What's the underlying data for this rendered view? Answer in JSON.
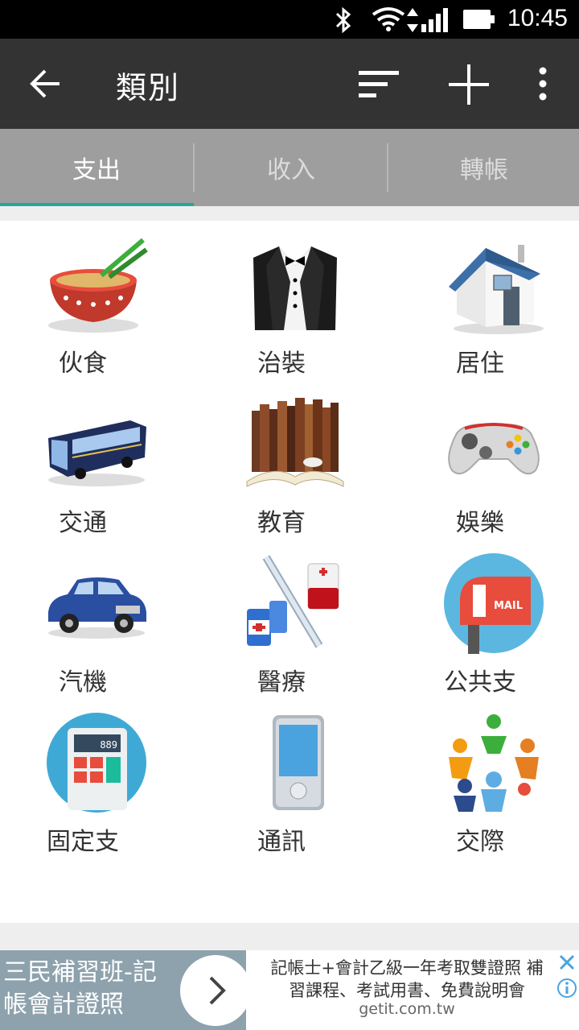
{
  "status_bar": {
    "time": "10:45"
  },
  "app_bar": {
    "title": "類別"
  },
  "tabs": [
    {
      "label": "支出",
      "active": true
    },
    {
      "label": "收入",
      "active": false
    },
    {
      "label": "轉帳",
      "active": false
    }
  ],
  "categories": [
    {
      "label": "伙食",
      "icon": "noodle-bowl-icon"
    },
    {
      "label": "治裝",
      "icon": "tuxedo-icon"
    },
    {
      "label": "居住",
      "icon": "house-icon"
    },
    {
      "label": "交通",
      "icon": "bus-icon"
    },
    {
      "label": "教育",
      "icon": "books-icon"
    },
    {
      "label": "娛樂",
      "icon": "gamepad-icon"
    },
    {
      "label": "汽機",
      "icon": "car-icon"
    },
    {
      "label": "醫療",
      "icon": "medical-icon"
    },
    {
      "label": "公共支",
      "icon": "mailbox-icon"
    },
    {
      "label": "固定支",
      "icon": "calculator-icon"
    },
    {
      "label": "通訊",
      "icon": "phone-icon"
    },
    {
      "label": "交際",
      "icon": "people-circle-icon"
    },
    {
      "label": "",
      "icon": "airplane-icon"
    },
    {
      "label": "",
      "icon": "money-icon"
    },
    {
      "label": "",
      "icon": "photo-icon"
    }
  ],
  "ad": {
    "left_text": "三民補習班-記帳會計證照",
    "right_text_line1": "記帳士+會計乙級一年考取雙證照 補",
    "right_text_line2": "習課程、考試用書、免費說明會",
    "domain": "getit.com.tw"
  },
  "colors": {
    "status_bar": "#000000",
    "app_bar": "#333333",
    "tab_bar": "#9e9e9e",
    "tab_indicator": "#26a69a",
    "ad_background": "#8ea2ad"
  }
}
